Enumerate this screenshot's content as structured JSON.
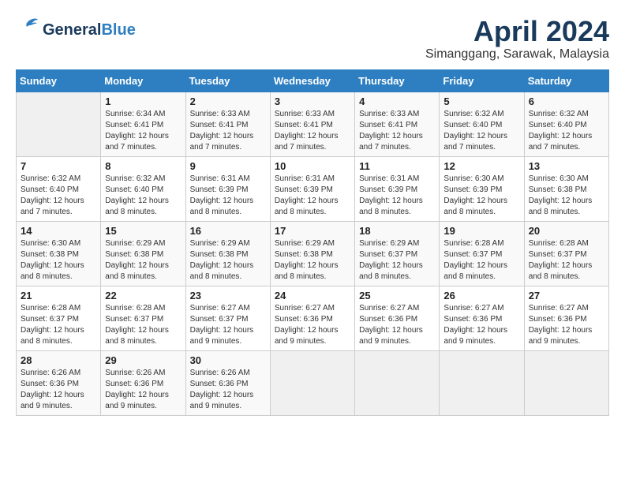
{
  "header": {
    "logo_general": "General",
    "logo_blue": "Blue",
    "month_title": "April 2024",
    "location": "Simanggang, Sarawak, Malaysia"
  },
  "weekdays": [
    "Sunday",
    "Monday",
    "Tuesday",
    "Wednesday",
    "Thursday",
    "Friday",
    "Saturday"
  ],
  "weeks": [
    [
      {
        "day": "",
        "info": ""
      },
      {
        "day": "1",
        "info": "Sunrise: 6:34 AM\nSunset: 6:41 PM\nDaylight: 12 hours\nand 7 minutes."
      },
      {
        "day": "2",
        "info": "Sunrise: 6:33 AM\nSunset: 6:41 PM\nDaylight: 12 hours\nand 7 minutes."
      },
      {
        "day": "3",
        "info": "Sunrise: 6:33 AM\nSunset: 6:41 PM\nDaylight: 12 hours\nand 7 minutes."
      },
      {
        "day": "4",
        "info": "Sunrise: 6:33 AM\nSunset: 6:41 PM\nDaylight: 12 hours\nand 7 minutes."
      },
      {
        "day": "5",
        "info": "Sunrise: 6:32 AM\nSunset: 6:40 PM\nDaylight: 12 hours\nand 7 minutes."
      },
      {
        "day": "6",
        "info": "Sunrise: 6:32 AM\nSunset: 6:40 PM\nDaylight: 12 hours\nand 7 minutes."
      }
    ],
    [
      {
        "day": "7",
        "info": "Sunrise: 6:32 AM\nSunset: 6:40 PM\nDaylight: 12 hours\nand 7 minutes."
      },
      {
        "day": "8",
        "info": "Sunrise: 6:32 AM\nSunset: 6:40 PM\nDaylight: 12 hours\nand 8 minutes."
      },
      {
        "day": "9",
        "info": "Sunrise: 6:31 AM\nSunset: 6:39 PM\nDaylight: 12 hours\nand 8 minutes."
      },
      {
        "day": "10",
        "info": "Sunrise: 6:31 AM\nSunset: 6:39 PM\nDaylight: 12 hours\nand 8 minutes."
      },
      {
        "day": "11",
        "info": "Sunrise: 6:31 AM\nSunset: 6:39 PM\nDaylight: 12 hours\nand 8 minutes."
      },
      {
        "day": "12",
        "info": "Sunrise: 6:30 AM\nSunset: 6:39 PM\nDaylight: 12 hours\nand 8 minutes."
      },
      {
        "day": "13",
        "info": "Sunrise: 6:30 AM\nSunset: 6:38 PM\nDaylight: 12 hours\nand 8 minutes."
      }
    ],
    [
      {
        "day": "14",
        "info": "Sunrise: 6:30 AM\nSunset: 6:38 PM\nDaylight: 12 hours\nand 8 minutes."
      },
      {
        "day": "15",
        "info": "Sunrise: 6:29 AM\nSunset: 6:38 PM\nDaylight: 12 hours\nand 8 minutes."
      },
      {
        "day": "16",
        "info": "Sunrise: 6:29 AM\nSunset: 6:38 PM\nDaylight: 12 hours\nand 8 minutes."
      },
      {
        "day": "17",
        "info": "Sunrise: 6:29 AM\nSunset: 6:38 PM\nDaylight: 12 hours\nand 8 minutes."
      },
      {
        "day": "18",
        "info": "Sunrise: 6:29 AM\nSunset: 6:37 PM\nDaylight: 12 hours\nand 8 minutes."
      },
      {
        "day": "19",
        "info": "Sunrise: 6:28 AM\nSunset: 6:37 PM\nDaylight: 12 hours\nand 8 minutes."
      },
      {
        "day": "20",
        "info": "Sunrise: 6:28 AM\nSunset: 6:37 PM\nDaylight: 12 hours\nand 8 minutes."
      }
    ],
    [
      {
        "day": "21",
        "info": "Sunrise: 6:28 AM\nSunset: 6:37 PM\nDaylight: 12 hours\nand 8 minutes."
      },
      {
        "day": "22",
        "info": "Sunrise: 6:28 AM\nSunset: 6:37 PM\nDaylight: 12 hours\nand 8 minutes."
      },
      {
        "day": "23",
        "info": "Sunrise: 6:27 AM\nSunset: 6:37 PM\nDaylight: 12 hours\nand 9 minutes."
      },
      {
        "day": "24",
        "info": "Sunrise: 6:27 AM\nSunset: 6:36 PM\nDaylight: 12 hours\nand 9 minutes."
      },
      {
        "day": "25",
        "info": "Sunrise: 6:27 AM\nSunset: 6:36 PM\nDaylight: 12 hours\nand 9 minutes."
      },
      {
        "day": "26",
        "info": "Sunrise: 6:27 AM\nSunset: 6:36 PM\nDaylight: 12 hours\nand 9 minutes."
      },
      {
        "day": "27",
        "info": "Sunrise: 6:27 AM\nSunset: 6:36 PM\nDaylight: 12 hours\nand 9 minutes."
      }
    ],
    [
      {
        "day": "28",
        "info": "Sunrise: 6:26 AM\nSunset: 6:36 PM\nDaylight: 12 hours\nand 9 minutes."
      },
      {
        "day": "29",
        "info": "Sunrise: 6:26 AM\nSunset: 6:36 PM\nDaylight: 12 hours\nand 9 minutes."
      },
      {
        "day": "30",
        "info": "Sunrise: 6:26 AM\nSunset: 6:36 PM\nDaylight: 12 hours\nand 9 minutes."
      },
      {
        "day": "",
        "info": ""
      },
      {
        "day": "",
        "info": ""
      },
      {
        "day": "",
        "info": ""
      },
      {
        "day": "",
        "info": ""
      }
    ]
  ]
}
